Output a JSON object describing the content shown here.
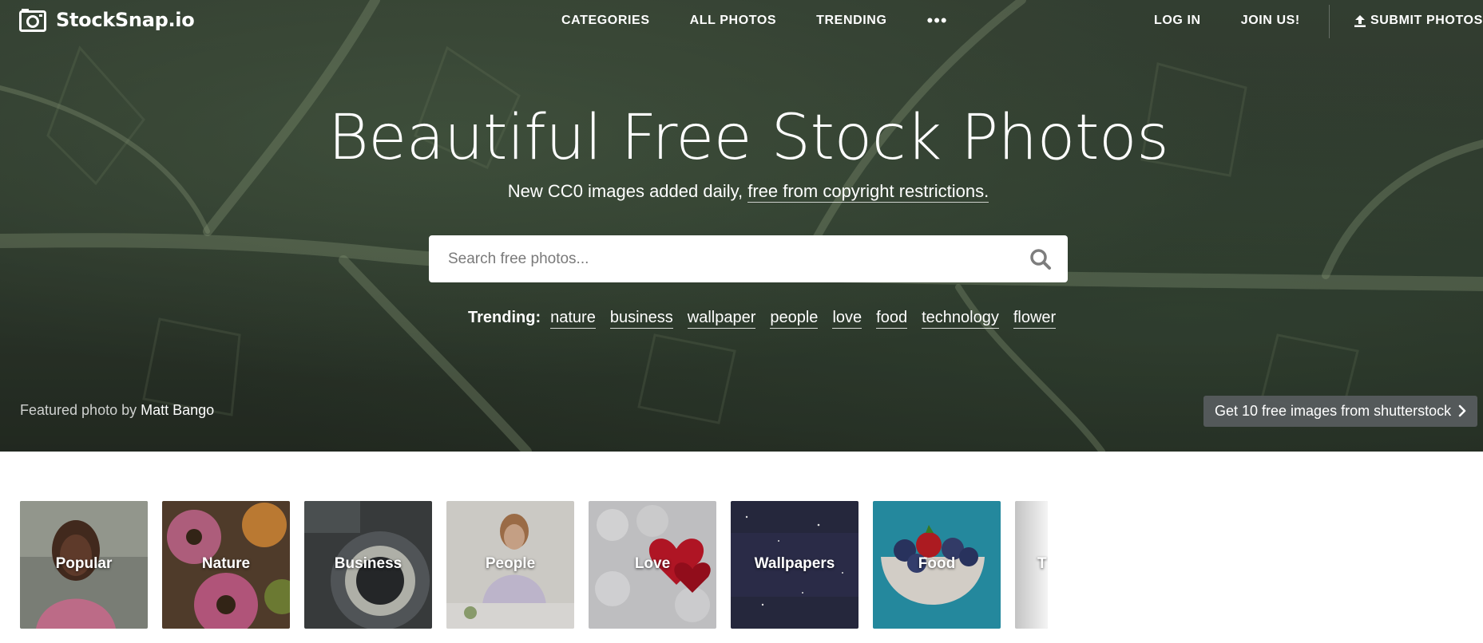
{
  "brand": {
    "name": "StockSnap.io",
    "logo_icon": "camera-icon"
  },
  "nav": {
    "center": [
      {
        "label": "CATEGORIES"
      },
      {
        "label": "ALL PHOTOS"
      },
      {
        "label": "TRENDING"
      }
    ],
    "more_label": "•••",
    "right": [
      {
        "label": "LOG IN"
      },
      {
        "label": "JOIN US!"
      }
    ],
    "submit_label": "SUBMIT PHOTOS",
    "submit_icon": "upload-icon"
  },
  "hero": {
    "title": "Beautiful Free Stock Photos",
    "subtitle_text": "New CC0 images added daily, ",
    "subtitle_link": "free from copyright restrictions.",
    "search": {
      "placeholder": "Search free photos...",
      "value": "",
      "icon": "search-icon"
    },
    "trending_label": "Trending:",
    "trending_tags": [
      "nature",
      "business",
      "wallpaper",
      "people",
      "love",
      "food",
      "technology",
      "flower"
    ],
    "featured_prefix": "Featured photo by ",
    "featured_author": "Matt Bango",
    "promo_label": "Get 10 free images from shutterstock",
    "promo_icon": "chevron-right-icon"
  },
  "categories": [
    {
      "label": "Popular"
    },
    {
      "label": "Nature"
    },
    {
      "label": "Business"
    },
    {
      "label": "People"
    },
    {
      "label": "Love"
    },
    {
      "label": "Wallpapers"
    },
    {
      "label": "Food"
    },
    {
      "label": "T"
    }
  ],
  "colors": {
    "hero_overlay": "#3b4a3a",
    "promo_bg": "#585c5e",
    "text_light": "#ffffff"
  }
}
